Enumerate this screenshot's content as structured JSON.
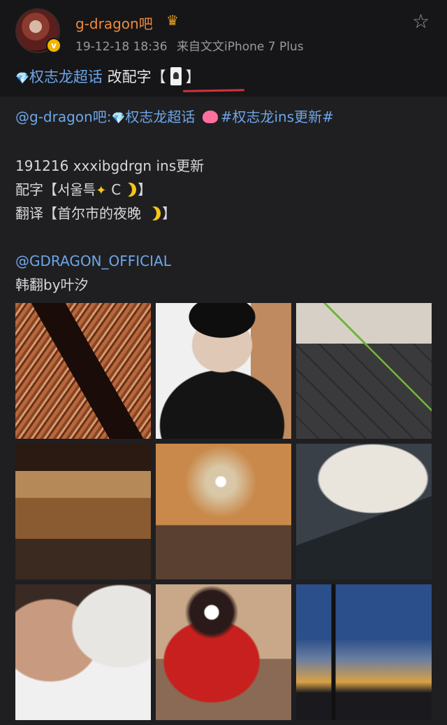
{
  "post": {
    "username": "g-dragon吧",
    "crown": "♛",
    "verified": "v",
    "date": "19-12-18 18:36",
    "source": "来自文文iPhone 7 Plus",
    "topic_prefix": "💎",
    "topic": "权志龙超话",
    "title_text": "改配字",
    "bracket_open": "【",
    "bracket_close": "】"
  },
  "content": {
    "mention": "@g-dragon吧:",
    "topic_gem": "💎",
    "topic": "权志龙超话",
    "hashtag": "#权志龙ins更新#",
    "line1": "191216 xxxibgdrgn ins更新",
    "line2_prefix": "配字【서울특",
    "line2_mid": "C",
    "line2_suffix": "】",
    "line3_prefix": "翻译【首尔市的夜晚",
    "line3_suffix": "】",
    "account": "@GDRAGON_OFFICIAL",
    "credit": "韩翻by叶汐"
  },
  "icons": {
    "star": "☆"
  },
  "photos": [
    "photo-1",
    "photo-2",
    "photo-3",
    "photo-4",
    "photo-5",
    "photo-6",
    "photo-7",
    "photo-8",
    "photo-9"
  ]
}
